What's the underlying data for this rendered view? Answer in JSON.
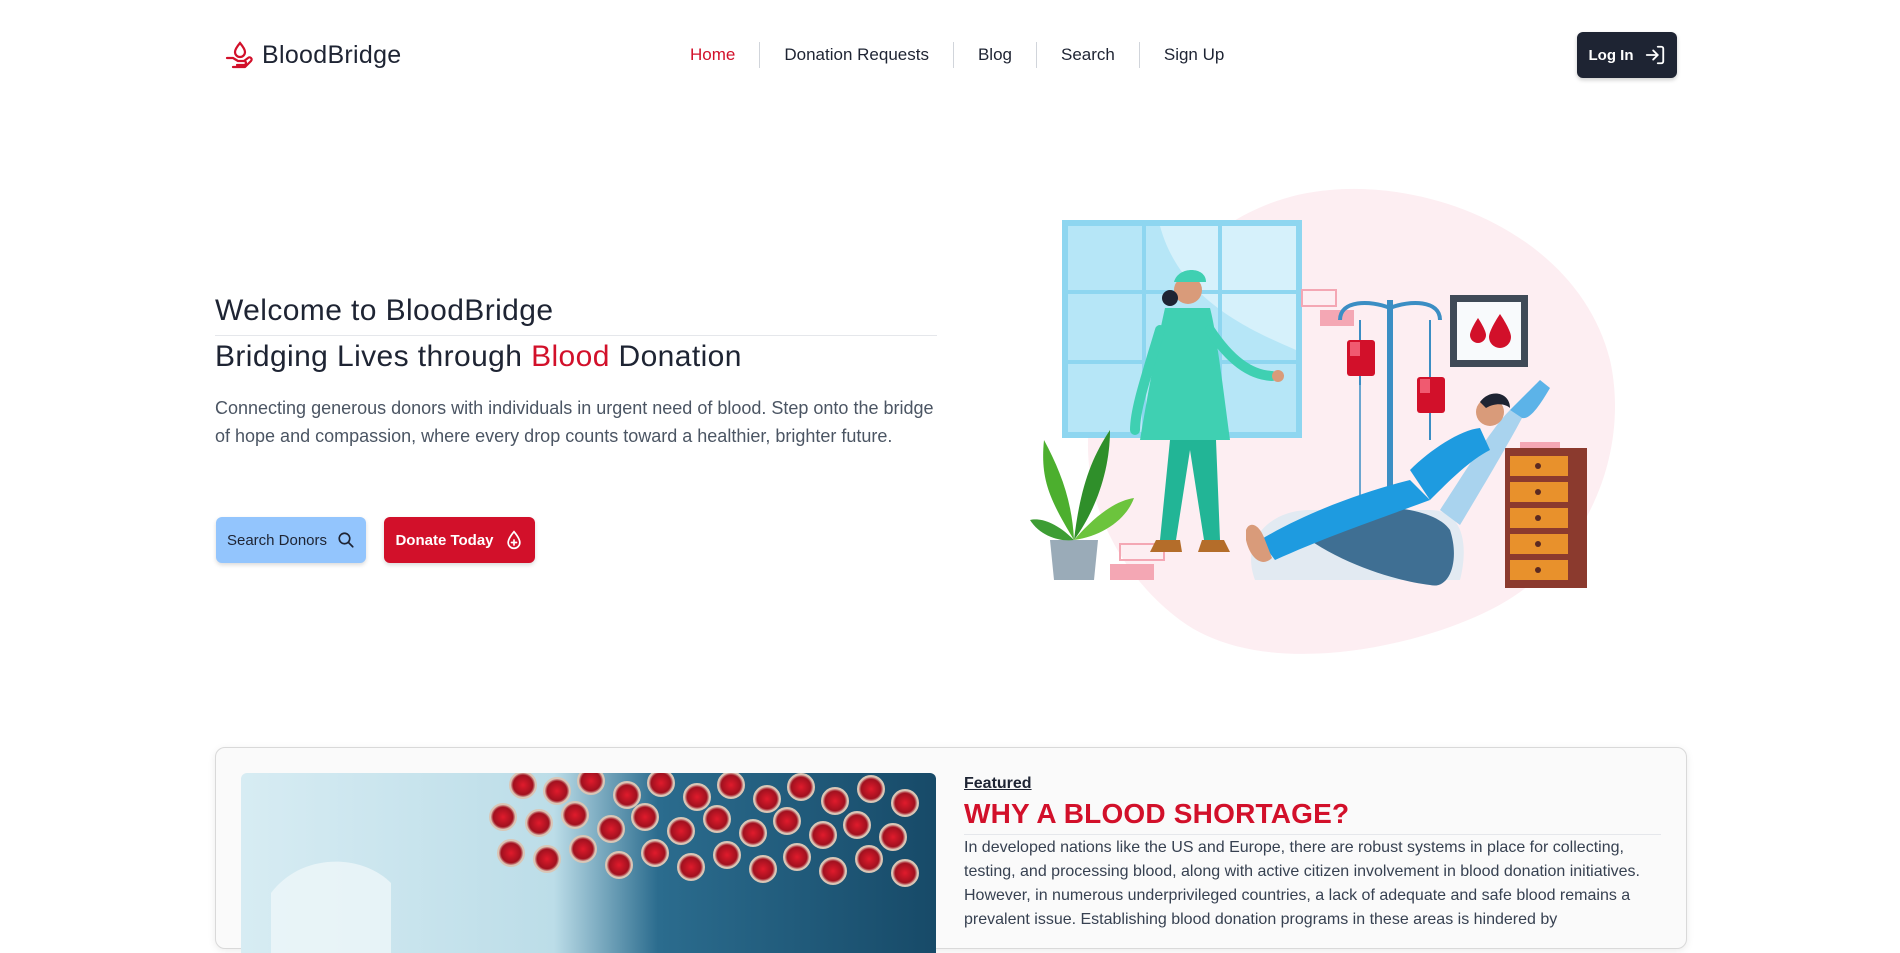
{
  "brand": {
    "name": "BloodBridge",
    "accent": "#d2102a",
    "dark": "#1e2433"
  },
  "nav": {
    "items": [
      {
        "label": "Home",
        "active": true
      },
      {
        "label": "Donation Requests",
        "active": false
      },
      {
        "label": "Blog",
        "active": false
      },
      {
        "label": "Search",
        "active": false
      },
      {
        "label": "Sign Up",
        "active": false
      }
    ],
    "login_label": "Log In"
  },
  "hero": {
    "title": "Welcome to BloodBridge",
    "subtitle_pre": "Bridging Lives through ",
    "subtitle_highlight": "Blood",
    "subtitle_post": " Donation",
    "description": "Connecting generous donors with individuals in urgent need of blood. Step onto the bridge of hope and compassion, where every drop counts toward a healthier, brighter future.",
    "search_button": "Search Donors",
    "donate_button": "Donate Today"
  },
  "featured": {
    "label": "Featured",
    "title": "WHY A BLOOD SHORTAGE?",
    "text": "In developed nations like the US and Europe, there are robust systems in place for collecting, testing, and processing blood, along with active citizen involvement in blood donation initiatives. However, in numerous underprivileged countries, a lack of adequate and safe blood remains a prevalent issue. Establishing blood donation programs in these areas is hindered by"
  }
}
